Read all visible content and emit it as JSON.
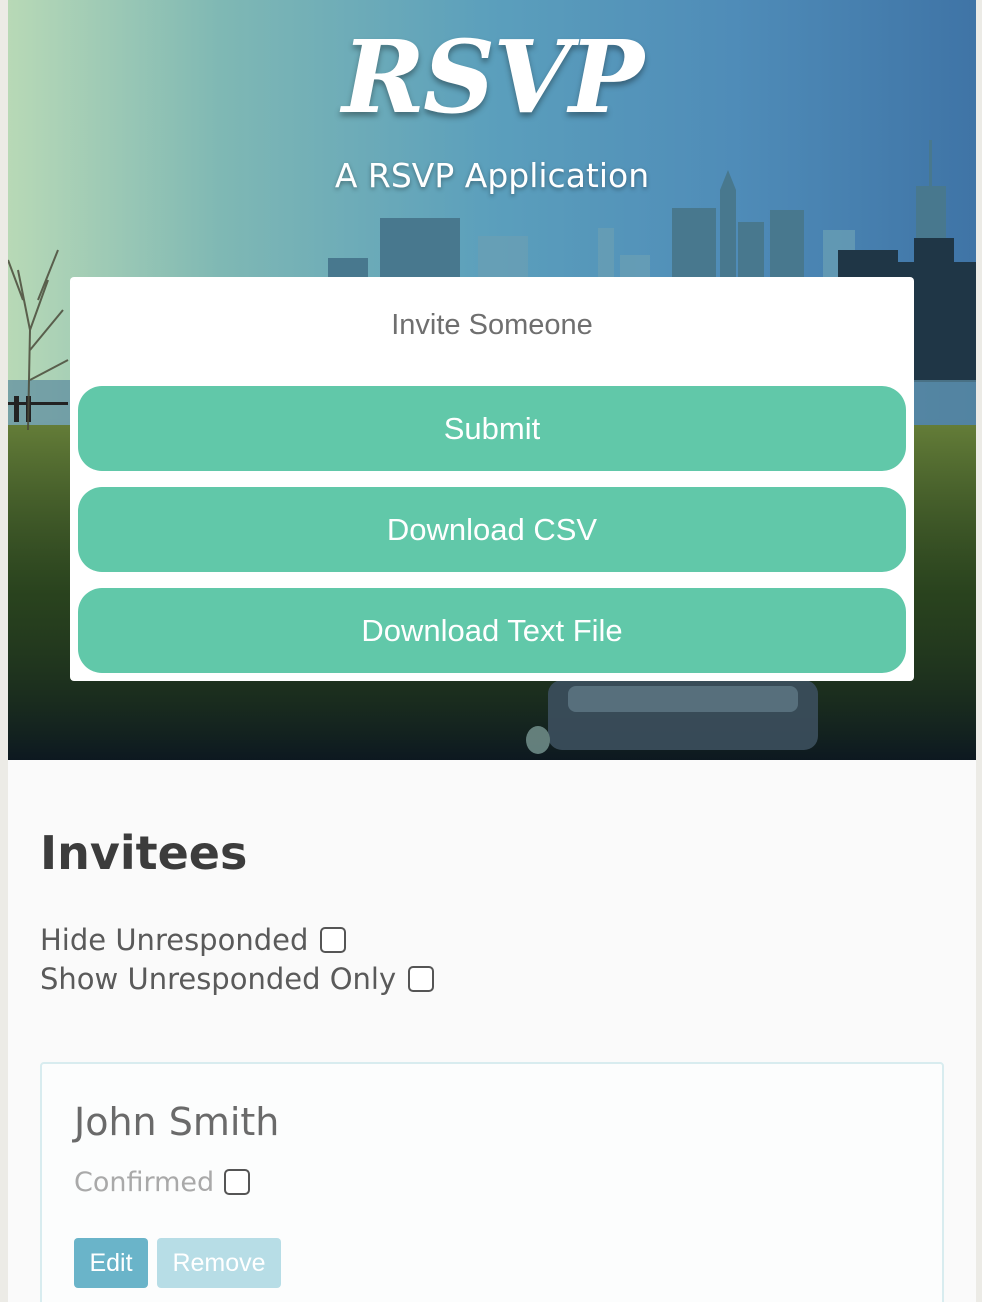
{
  "header": {
    "logo_text": "RSVP",
    "tagline": "A RSVP Application"
  },
  "invite_form": {
    "title": "Invite Someone",
    "submit_label": "Submit",
    "download_csv_label": "Download CSV",
    "download_text_label": "Download Text File"
  },
  "invitees": {
    "title": "Invitees",
    "filters": {
      "hide_unresponded_label": "Hide Unresponded",
      "hide_unresponded_checked": false,
      "show_unresponded_only_label": "Show Unresponded Only",
      "show_unresponded_only_checked": false
    },
    "list": [
      {
        "name": "John Smith",
        "confirmed_label": "Confirmed",
        "confirmed": false,
        "edit_label": "Edit",
        "remove_label": "Remove"
      }
    ]
  },
  "colors": {
    "accent_green": "#61c8a9",
    "edit_blue": "#6ab4c9",
    "remove_light_blue": "#b7dde6"
  }
}
